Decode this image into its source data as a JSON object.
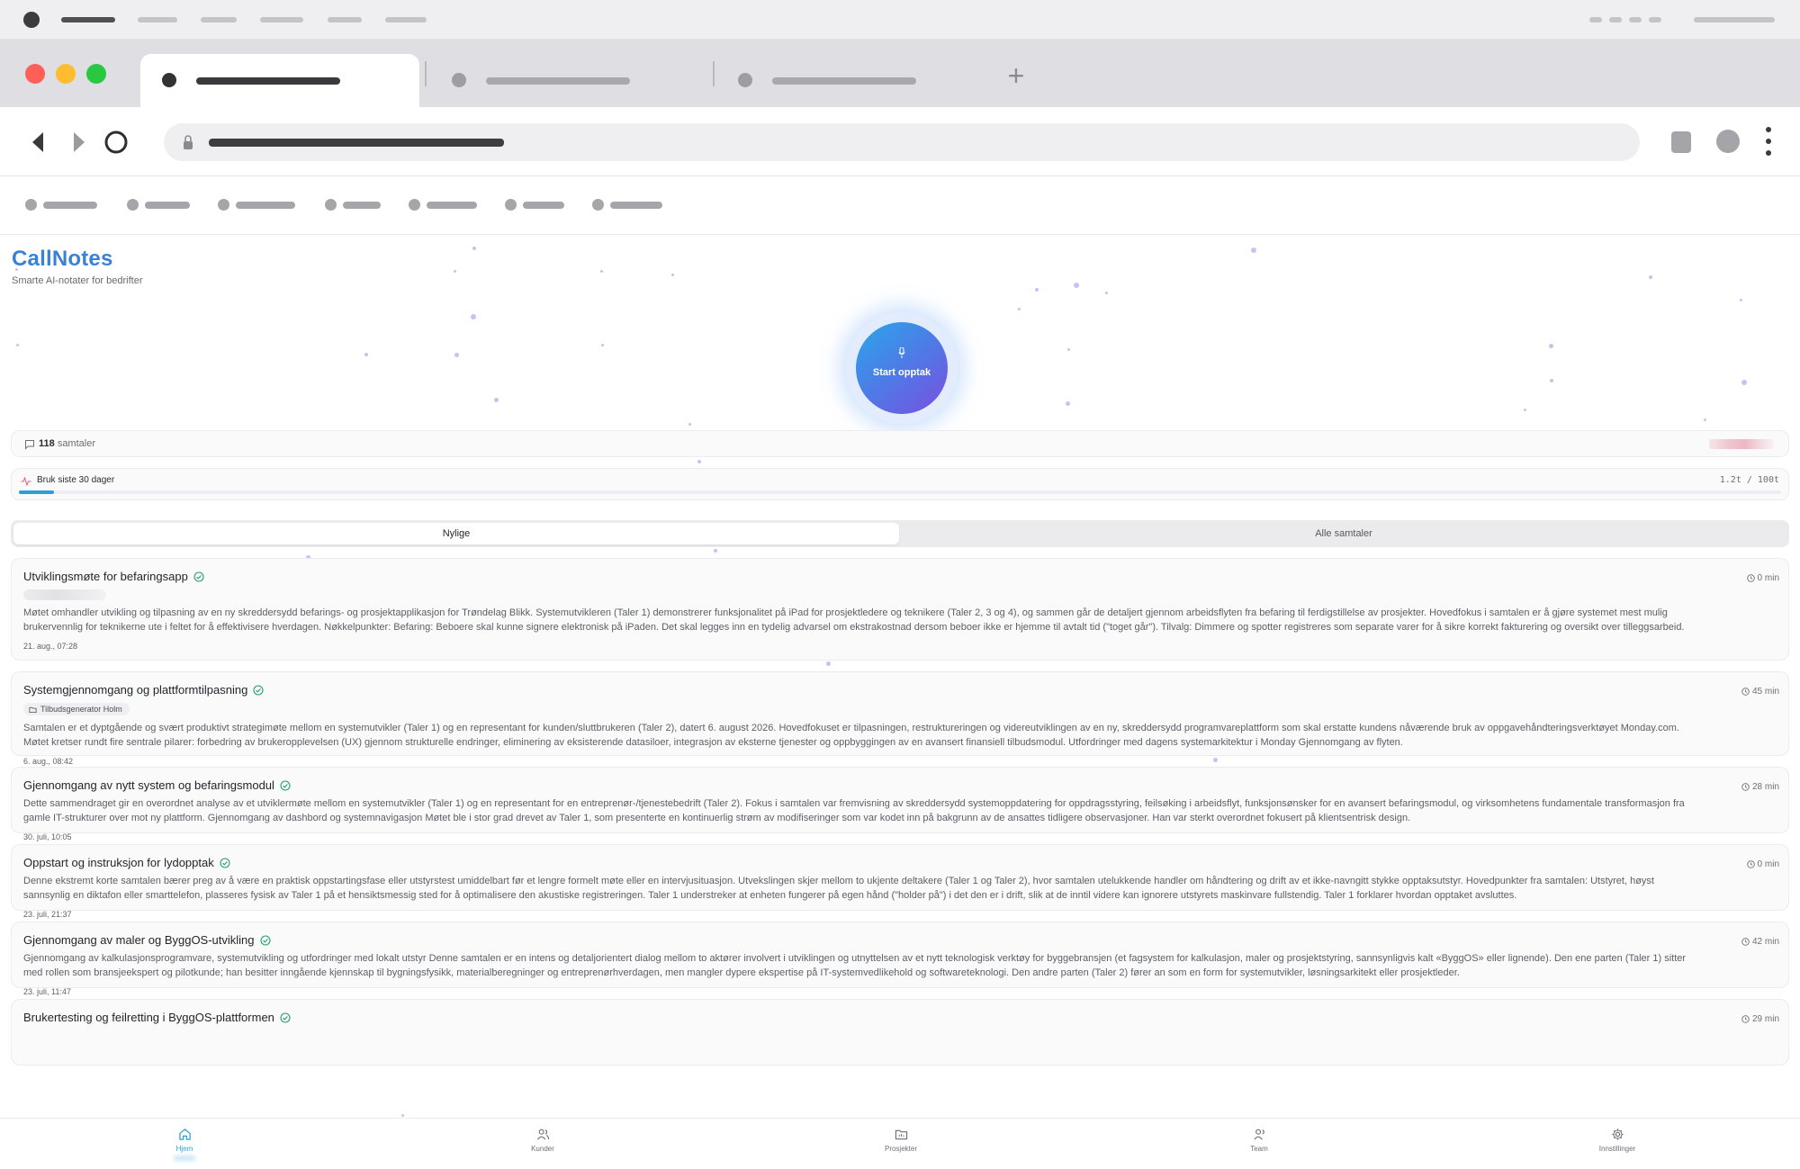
{
  "brand": {
    "title": "CallNotes",
    "subtitle": "Smarte AI-notater for bedrifter",
    "accent": "#3b82d6"
  },
  "record_button": {
    "label": "Start opptak",
    "icon": "mic-icon"
  },
  "stats": {
    "conversation_count": "118",
    "conversation_label": "samtaler"
  },
  "usage": {
    "label": "Bruk siste 30 dager",
    "value_text": "1.2t / 100t",
    "used_fraction": 0.012
  },
  "tabs": [
    {
      "label": "Nylige",
      "active": true
    },
    {
      "label": "Alle samtaler",
      "active": false
    }
  ],
  "calls": [
    {
      "title": "Utviklingsmøte for befaringsapp",
      "duration": "0 min",
      "tag": "",
      "summary": "Møtet omhandler utvikling og tilpasning av en ny skreddersydd befarings- og prosjektapplikasjon for Trøndelag Blikk. Systemutvikleren (Taler 1) demonstrerer funksjonalitet på iPad for prosjektledere og teknikere (Taler 2, 3 og 4), og sammen går de detaljert gjennom arbeidsflyten fra befaring til ferdigstillelse av prosjekter. Hovedfokus i samtalen er å gjøre systemet mest mulig brukervennlig for teknikerne ute i feltet for å effektivisere hverdagen. Nøkkelpunkter: Befaring: Beboere skal kunne signere elektronisk på iPaden. Det skal legges inn en tydelig advarsel om ekstrakostnad dersom beboer ikke er hjemme til avtalt tid (\"toget går\"). Tilvalg: Dimmere og spotter registreres som separate varer for å sikre korrekt fakturering og oversikt over tilleggsarbeid.",
      "date": "21. aug., 07:28"
    },
    {
      "title": "Systemgjennomgang og plattformtilpasning",
      "duration": "45 min",
      "tag": "Tilbudsgenerator Holm",
      "summary": "Samtalen er et dyptgående og svært produktivt strategimøte mellom en systemutvikler (Taler 1) og en representant for kunden/sluttbrukeren (Taler 2), datert 6. august 2026. Hovedfokuset er tilpasningen, restruktureringen og videreutviklingen av en ny, skreddersydd programvareplattform som skal erstatte kundens nåværende bruk av oppgavehåndteringsverktøyet Monday.com. Møtet kretser rundt fire sentrale pilarer: forbedring av brukeropplevelsen (UX) gjennom strukturelle endringer, eliminering av eksisterende datasiloer, integrasjon av eksterne tjenester og oppbyggingen av en avansert finansiell tilbudsmodul. Utfordringer med dagens systemarkitektur i Monday Gjennomgang av flyten.",
      "date": "6. aug., 08:42"
    },
    {
      "title": "Gjennomgang av nytt system og befaringsmodul",
      "duration": "28 min",
      "tag": "",
      "summary": "Dette sammendraget gir en overordnet analyse av et utviklermøte mellom en systemutvikler (Taler 1) og en representant for en entreprenør-/tjenestebedrift (Taler 2). Fokus i samtalen var fremvisning av skreddersydd systemoppdatering for oppdragsstyring, feilsøking i arbeidsflyt, funksjonsønsker for en avansert befaringsmodul, og virksomhetens fundamentale transformasjon fra gamle IT-strukturer over mot ny plattform. Gjennomgang av dashbord og systemnavigasjon Møtet ble i stor grad drevet av Taler 1, som presenterte en kontinuerlig strøm av modifiseringer som var kodet inn på bakgrunn av de ansattes tidligere observasjoner. Han var sterkt overordnet fokusert på klientsentrisk design.",
      "date": "30. juli, 10:05"
    },
    {
      "title": "Oppstart og instruksjon for lydopptak",
      "duration": "0 min",
      "tag": "",
      "summary": "Denne ekstremt korte samtalen bærer preg av å være en praktisk oppstartingsfase eller utstyrstest umiddelbart før et lengre formelt møte eller en intervjusituasjon. Utvekslingen skjer mellom to ukjente deltakere (Taler 1 og Taler 2), hvor samtalen utelukkende handler om håndtering og drift av et ikke-navngitt stykke opptaksutstyr. Hovedpunkter fra samtalen: Utstyret, høyst sannsynlig en diktafon eller smarttelefon, plasseres fysisk av Taler 1 på et hensiktsmessig sted for å optimalisere den akustiske registreringen. Taler 1 understreker at enheten fungerer på egen hånd (\"holder på\") i det den er i drift, slik at de inntil videre kan ignorere utstyrets maskinvare fullstendig. Taler 1 forklarer hvordan opptaket avsluttes.",
      "date": "23. juli, 21:37"
    },
    {
      "title": "Gjennomgang av maler og ByggOS-utvikling",
      "duration": "42 min",
      "tag": "",
      "summary": "Gjennomgang av kalkulasjonsprogramvare, systemutvikling og utfordringer med lokalt utstyr Denne samtalen er en intens og detaljorientert dialog mellom to aktører involvert i utviklingen og utnyttelsen av et nytt teknologisk verktøy for byggebransjen (et fagsystem for kalkulasjon, maler og prosjektstyring, sannsynligvis kalt «ByggOS» eller lignende). Den ene parten (Taler 1) sitter med rollen som bransjeekspert og pilotkunde; han besitter inngående kjennskap til bygningsfysikk, materialberegninger og entreprenørhverdagen, men mangler dypere ekspertise på IT-systemvedlikehold og softwareteknologi. Den andre parten (Taler 2) fører an som en form for systemutvikler, løsningsarkitekt eller prosjektleder.",
      "date": "23. juli, 11:47"
    },
    {
      "title": "Brukertesting og feilretting i ByggOS-plattformen",
      "duration": "29 min",
      "tag": "",
      "summary": "",
      "date": ""
    }
  ],
  "bottom_nav": [
    {
      "label": "Hjem",
      "icon": "home-icon",
      "active": true
    },
    {
      "label": "Kunder",
      "icon": "users-icon",
      "active": false
    },
    {
      "label": "Prosjekter",
      "icon": "folder-icon",
      "active": false
    },
    {
      "label": "Team",
      "icon": "team-icon",
      "active": false
    },
    {
      "label": "Innstillinger",
      "icon": "gear-icon",
      "active": false
    }
  ],
  "colors": {
    "record_gradient_start": "#2aa7e9",
    "record_gradient_end": "#7a4fe0",
    "usage_bar": "#2f9ed8",
    "check": "#22a06b"
  }
}
